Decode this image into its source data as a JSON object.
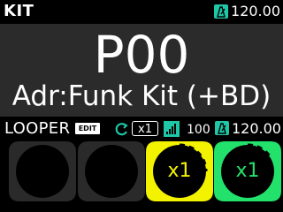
{
  "header": {
    "kit_label": "KIT",
    "tempo": "120.00"
  },
  "main": {
    "preset": "P00",
    "kit_name": "Adr:Funk Kit (+BD)"
  },
  "looper": {
    "label": "LOOPER",
    "edit_badge": "EDIT",
    "multiplier": "x1",
    "volume": "100",
    "tempo": "120.00",
    "icons": [
      "loop-icon",
      "volume-bars-icon",
      "metronome-icon"
    ]
  },
  "pads": [
    {
      "state": "empty",
      "label": "",
      "color": "#2a2a2a"
    },
    {
      "state": "empty",
      "label": "",
      "color": "#2a2a2a"
    },
    {
      "state": "yellow",
      "label": "x1",
      "color": "#f3f300"
    },
    {
      "state": "green",
      "label": "x1",
      "color": "#22e26b"
    }
  ],
  "colors": {
    "accent_teal": "#1ec7a6",
    "panel_gray": "#2b2b2b",
    "yellow": "#f3f300",
    "green": "#22e26b"
  }
}
